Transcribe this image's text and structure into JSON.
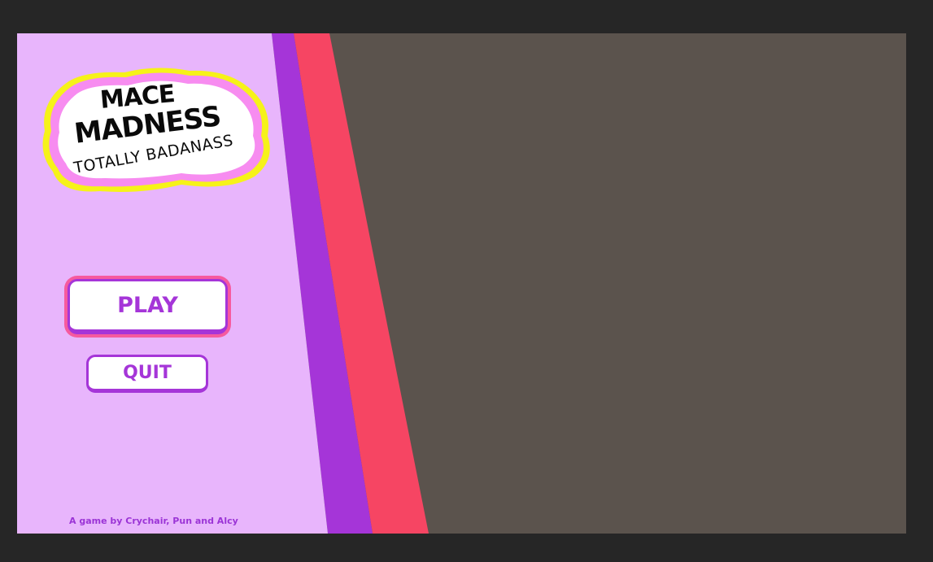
{
  "logo": {
    "title_line1": "MACE",
    "title_line2": "MADNESS",
    "subtitle": "TOTALLY BADANASS"
  },
  "menu": {
    "play_label": "PLAY",
    "quit_label": "QUIT"
  },
  "credits": "A game by Crychair, Pun and Alcy",
  "colors": {
    "menu_panel": "#e8b5fc",
    "purple_stripe": "#a535d8",
    "red_stripe": "#f64563",
    "background": "#5b534d",
    "window_frame": "#262626",
    "logo_outline_pink": "#f78cf0",
    "logo_outline_yellow": "#f6f219"
  }
}
